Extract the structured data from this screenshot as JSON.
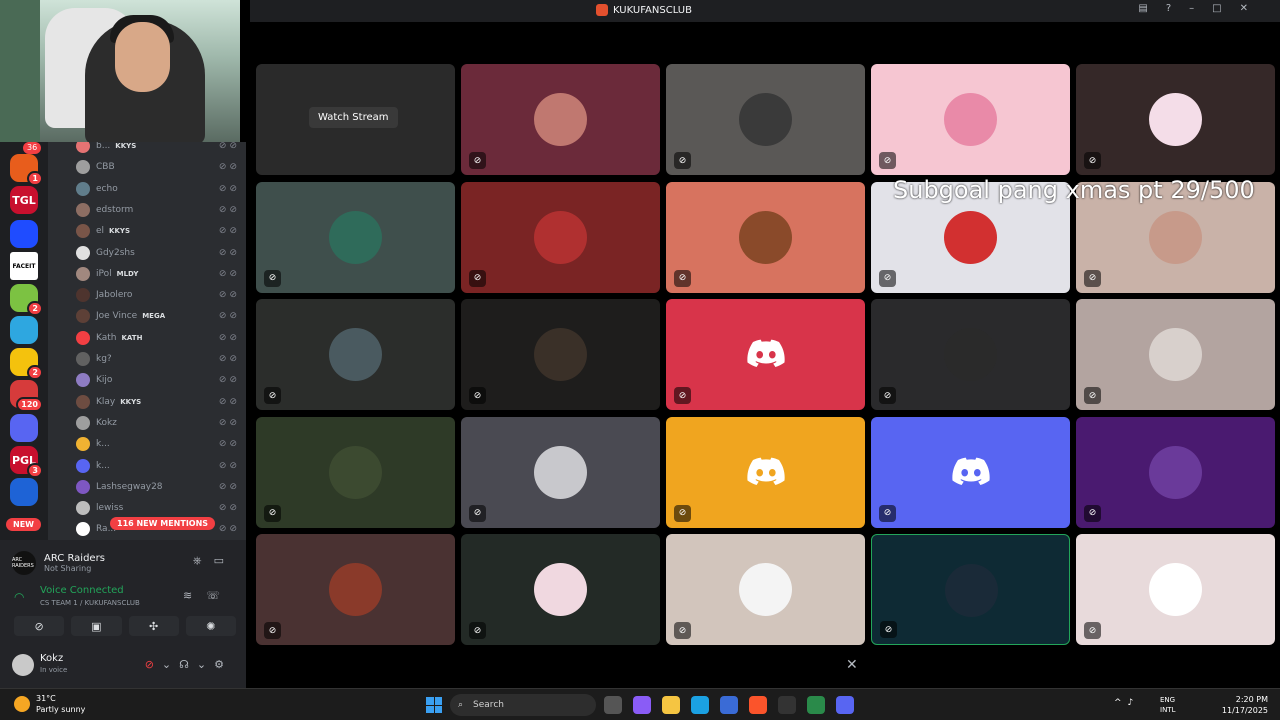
{
  "window": {
    "title": "KUKUFANSCLUB"
  },
  "server_rail": {
    "top_badge": "36",
    "servers": [
      {
        "name": "server-1",
        "count": "1",
        "color": "#e85d1c"
      },
      {
        "name": "server-tgl",
        "count": "",
        "color": "#c8102e",
        "label": "TGL"
      },
      {
        "name": "server-3",
        "count": "",
        "color": "#1f4cff"
      },
      {
        "name": "server-faceit",
        "count": "",
        "color": "#ffffff",
        "label": "FACEIT"
      },
      {
        "name": "server-5",
        "count": "2",
        "color": "#7cc242"
      },
      {
        "name": "server-6",
        "count": "",
        "color": "#2ea7e0"
      },
      {
        "name": "server-7",
        "count": "2",
        "color": "#f4c20d"
      },
      {
        "name": "server-8",
        "count": "120",
        "color": "#d63b3b"
      },
      {
        "name": "server-folder",
        "count": "",
        "color": "#5865f2"
      },
      {
        "name": "server-pgl",
        "count": "3",
        "color": "#c8102e",
        "label": "PGL"
      },
      {
        "name": "server-11",
        "count": "",
        "color": "#1e63d6"
      }
    ],
    "new_label": "NEW"
  },
  "members": [
    {
      "name": "b...",
      "tag": "KKYS",
      "color": "#e57373"
    },
    {
      "name": "CBB",
      "tag": "",
      "color": "#9e9e9e"
    },
    {
      "name": "echo",
      "tag": "",
      "color": "#607d8b"
    },
    {
      "name": "edstorm",
      "tag": "",
      "color": "#8d6e63"
    },
    {
      "name": "el",
      "tag": "KKYS",
      "color": "#795548"
    },
    {
      "name": "Gdy2shs",
      "tag": "",
      "color": "#e0e0e0"
    },
    {
      "name": "iPol",
      "tag": "MLDY",
      "color": "#a1887f"
    },
    {
      "name": "Jabolero",
      "tag": "",
      "color": "#4e342e"
    },
    {
      "name": "Joe Vince",
      "tag": "MEGA",
      "color": "#5d4037"
    },
    {
      "name": "Kath",
      "tag": "KATH",
      "color": "#f23f43"
    },
    {
      "name": "kg?",
      "tag": "",
      "color": "#616161"
    },
    {
      "name": "Kijo",
      "tag": "",
      "color": "#8e7cc3"
    },
    {
      "name": "Klay",
      "tag": "KKYS",
      "color": "#6d4c41"
    },
    {
      "name": "Kokz",
      "tag": "",
      "color": "#9e9e9e"
    },
    {
      "name": "k...",
      "tag": "",
      "color": "#f0b232"
    },
    {
      "name": "k...",
      "tag": "",
      "color": "#5865f2"
    },
    {
      "name": "Lashsegway28",
      "tag": "",
      "color": "#7e57c2"
    },
    {
      "name": "lewiss",
      "tag": "",
      "color": "#bdbdbd"
    },
    {
      "name": "Ra...",
      "tag": "",
      "color": "#ffffff"
    }
  ],
  "mentions_label": "116 NEW MENTIONS",
  "activity": {
    "game": "ARC Raiders",
    "status": "Not Sharing",
    "icon_label": "ARC RAIDERS"
  },
  "voice": {
    "status": "Voice Connected",
    "channel": "CS TEAM 1 / KUKUFANSCLUB"
  },
  "user": {
    "name": "Kokz",
    "status": "In voice"
  },
  "stage": {
    "watch_stream_label": "Watch Stream",
    "overlay_text": "Subgoal pang xmas pt  29/500",
    "tiles": [
      {
        "bg": "#2a2a2a",
        "kind": "stream"
      },
      {
        "bg": "#6b2a3a",
        "kind": "avatar",
        "av": "#c07870"
      },
      {
        "bg": "#5a5856",
        "kind": "avatar",
        "av": "#3a3a3a"
      },
      {
        "bg": "#f6c6d2",
        "kind": "avatar",
        "av": "#e98aa8"
      },
      {
        "bg": "#352828",
        "kind": "avatar",
        "av": "#f4dde8"
      },
      {
        "bg": "#3f4f4c",
        "kind": "avatar",
        "av": "#2f6b5a"
      },
      {
        "bg": "#7a2424",
        "kind": "avatar",
        "av": "#b03030"
      },
      {
        "bg": "#d7735f",
        "kind": "avatar",
        "av": "#8a4a2a"
      },
      {
        "bg": "#e2e2e8",
        "kind": "avatar",
        "av": "#d23030"
      },
      {
        "bg": "#c9b2a8",
        "kind": "avatar",
        "av": "#c79a8a"
      },
      {
        "bg": "#2b2d2b",
        "kind": "avatar",
        "av": "#4a5a60"
      },
      {
        "bg": "#1e1d1c",
        "kind": "avatar",
        "av": "#3a3028"
      },
      {
        "bg": "#d8344a",
        "kind": "discord",
        "av": ""
      },
      {
        "bg": "#2a2a2c",
        "kind": "avatar",
        "av": "#2a2a2a"
      },
      {
        "bg": "#b3a4a0",
        "kind": "avatar",
        "av": "#d8d0cc"
      },
      {
        "bg": "#2e3a27",
        "kind": "avatar",
        "av": "#3c4a30"
      },
      {
        "bg": "#4a4a52",
        "kind": "avatar",
        "av": "#c8c8cc"
      },
      {
        "bg": "#f0a51f",
        "kind": "discord",
        "av": ""
      },
      {
        "bg": "#5865f2",
        "kind": "discord",
        "av": ""
      },
      {
        "bg": "#4a1a70",
        "kind": "avatar",
        "av": "#6a3a9a"
      },
      {
        "bg": "#4a3232",
        "kind": "avatar",
        "av": "#8a3a2a"
      },
      {
        "bg": "#232a26",
        "kind": "avatar",
        "av": "#f0d8e0"
      },
      {
        "bg": "#d2c5bc",
        "kind": "avatar",
        "av": "#f4f4f4"
      },
      {
        "bg": "#0e2a34",
        "kind": "avatar",
        "av": "#1a2a38",
        "selected": true
      },
      {
        "bg": "#e8dadb",
        "kind": "avatar",
        "av": "#ffffff"
      }
    ]
  },
  "taskbar": {
    "temp": "31°C",
    "weather": "Partly sunny",
    "search_placeholder": "Search",
    "lang_top": "ENG",
    "lang_bottom": "INTL",
    "time": "2:20 PM",
    "date": "11/17/2025"
  }
}
